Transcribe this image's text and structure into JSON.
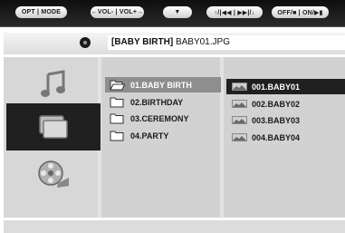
{
  "top_controls": [
    {
      "label": "OPT | MODE"
    },
    {
      "label": "←VOL- | VOL+→"
    },
    {
      "label": "▼",
      "icon": "chevron-down-icon"
    },
    {
      "label": "↑/|◀◀ | ▶▶|/↓"
    },
    {
      "label": "OFF/■ | ON/▶▮"
    }
  ],
  "path": {
    "folder": "[BABY BIRTH]",
    "file": "BABY01.JPG",
    "icon": "disc-icon"
  },
  "sidebar": {
    "items": [
      {
        "name": "music",
        "icon": "music-note-icon",
        "selected": false
      },
      {
        "name": "photo",
        "icon": "photo-stack-icon",
        "selected": true
      },
      {
        "name": "video",
        "icon": "film-reel-icon",
        "selected": false
      }
    ]
  },
  "folders": [
    {
      "label": "01.BABY BIRTH",
      "selected": true,
      "open": true
    },
    {
      "label": "02.BIRTHDAY",
      "selected": false,
      "open": false
    },
    {
      "label": "03.CEREMONY",
      "selected": false,
      "open": false
    },
    {
      "label": "04.PARTY",
      "selected": false,
      "open": false
    }
  ],
  "files": [
    {
      "label": "001.BABY01",
      "selected": true
    },
    {
      "label": "002.BABY02",
      "selected": false
    },
    {
      "label": "003.BABY03",
      "selected": false
    },
    {
      "label": "004.BABY04",
      "selected": false
    }
  ],
  "colors": {
    "top_bar": "#111111",
    "selection_dark": "#202020",
    "selection_folder": "#8e8e8e",
    "panel": "#d2d2d2"
  }
}
